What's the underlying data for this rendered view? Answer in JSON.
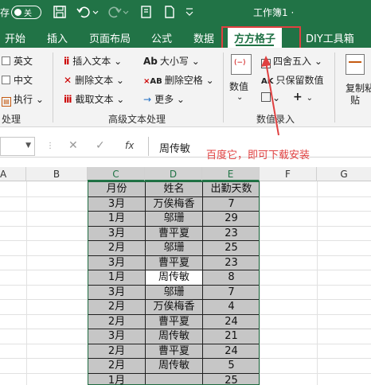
{
  "titlebar": {
    "autosave_label": "存",
    "autosave_state": "关",
    "filename": "工作簿1 ·",
    "accent": "#217346"
  },
  "tabs": [
    {
      "label": "开始"
    },
    {
      "label": "插入"
    },
    {
      "label": "页面布局"
    },
    {
      "label": "公式"
    },
    {
      "label": "数据"
    },
    {
      "label": "方方格子",
      "active": true
    },
    {
      "label": "DIY工具箱"
    }
  ],
  "ribbon": {
    "left_group": {
      "items": [
        "英文",
        "中文",
        "执行"
      ],
      "label": "处理"
    },
    "text_group": {
      "col1": [
        "插入文本",
        "删除文本",
        "截取文本"
      ],
      "col2": [
        "大小写",
        "删除空格",
        "更多"
      ],
      "label": "高级文本处理"
    },
    "number_group": {
      "value_button": "数值",
      "round_button": "四舍五入",
      "keep_button": "只保留数值",
      "label": "数值录入"
    },
    "copy_group": {
      "line1": "复制粘",
      "line2": "贴"
    }
  },
  "formulabar": {
    "formula_value": "周传敏",
    "fx_label": "fx"
  },
  "columns": [
    "A",
    "B",
    "C",
    "D",
    "E",
    "F",
    "G"
  ],
  "table": {
    "headers": [
      "月份",
      "姓名",
      "出勤天数"
    ],
    "rows": [
      [
        "3月",
        "万俟梅香",
        "7"
      ],
      [
        "1月",
        "邬珊",
        "29"
      ],
      [
        "3月",
        "曹平夏",
        "23"
      ],
      [
        "2月",
        "邬珊",
        "25"
      ],
      [
        "3月",
        "曹平夏",
        "23"
      ],
      [
        "1月",
        "周传敏",
        "8"
      ],
      [
        "3月",
        "邬珊",
        "7"
      ],
      [
        "2月",
        "万俟梅香",
        "4"
      ],
      [
        "2月",
        "曹平夏",
        "24"
      ],
      [
        "3月",
        "周传敏",
        "21"
      ],
      [
        "2月",
        "曹平夏",
        "24"
      ],
      [
        "2月",
        "周传敏",
        "5"
      ],
      [
        "1月",
        "",
        "25"
      ]
    ]
  },
  "annotation": {
    "text": "百度它，即可下载安装",
    "color": "#e04040"
  }
}
